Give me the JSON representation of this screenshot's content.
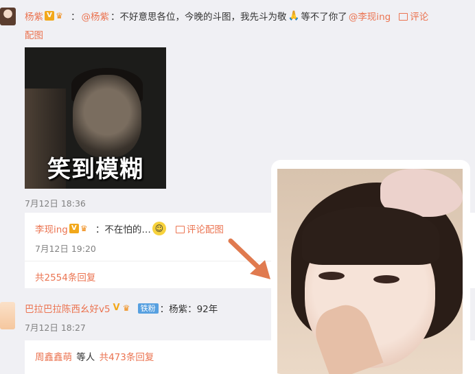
{
  "post": {
    "author": "杨紫",
    "colon": "：",
    "mention": "@杨紫",
    "text": "：不好意思各位，今晚的斗图，我先斗为敬",
    "text2": "等不了你了",
    "mention2": "@李现ing",
    "reply_action": "评论",
    "pic_action": "配图",
    "meme_caption": "笑到模糊",
    "time": "7月12日 18:36"
  },
  "reply1": {
    "author": "李现ing",
    "text": "：不在怕的…",
    "emoji": "smile-emoji",
    "action": "评论配图",
    "time": "7月12日 19:20",
    "count_text": "共2554条回复"
  },
  "comment2": {
    "author": "巴拉巴拉陈西幺好v5",
    "fan_tag": "铁粉",
    "text": "：杨紫：92年",
    "time": "7月12日 18:27"
  },
  "reply2": {
    "names": "周鑫鑫萌",
    "mid": " 等人 ",
    "count_text": "共473条回复"
  },
  "colors": {
    "link": "#eb7350",
    "badge": "#f2a81b",
    "fan": "#57a0e0",
    "arrow": "#e07a4f"
  }
}
